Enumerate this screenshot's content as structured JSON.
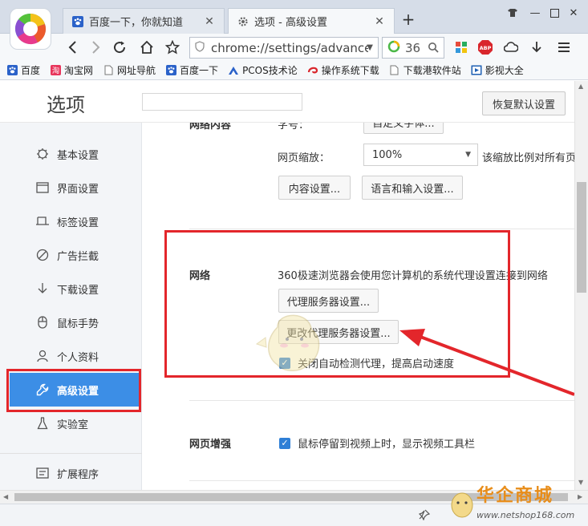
{
  "browser": {
    "tabs": [
      {
        "title": "百度一下，你就知道",
        "active": false,
        "icon": "baidu-paw-icon"
      },
      {
        "title": "选项 - 高级设置",
        "active": true,
        "icon": "gear-icon"
      }
    ],
    "address_url": "chrome://settings/advanced",
    "search_count": "36",
    "accent_color": "#3c8ee6"
  },
  "bookmarks": [
    {
      "label": "百度",
      "icon": "baidu-paw-icon"
    },
    {
      "label": "淘宝网",
      "icon": "taobao-icon"
    },
    {
      "label": "网址导航",
      "icon": "page-icon"
    },
    {
      "label": "百度一下",
      "icon": "baidu-paw-icon"
    },
    {
      "label": "PCOS技术论",
      "icon": "pcos-icon"
    },
    {
      "label": "操作系统下载",
      "icon": "swirl-icon"
    },
    {
      "label": "下载港软件站",
      "icon": "page-icon"
    },
    {
      "label": "影视大全",
      "icon": "film-icon"
    }
  ],
  "settings": {
    "title": "选项",
    "reset_label": "恢复默认设置",
    "nav": [
      {
        "label": "基本设置",
        "icon": "gear-icon"
      },
      {
        "label": "界面设置",
        "icon": "window-icon"
      },
      {
        "label": "标签设置",
        "icon": "tab-icon"
      },
      {
        "label": "广告拦截",
        "icon": "block-icon"
      },
      {
        "label": "下载设置",
        "icon": "download-icon"
      },
      {
        "label": "鼠标手势",
        "icon": "mouse-icon"
      },
      {
        "label": "个人资料",
        "icon": "person-icon"
      },
      {
        "label": "高级设置",
        "icon": "wrench-icon",
        "active": true
      },
      {
        "label": "实验室",
        "icon": "flask-icon"
      },
      {
        "label": "扩展程序",
        "icon": "extension-icon"
      }
    ],
    "web_content": {
      "label_partial": "网络内容",
      "font_size_partial": "字号：",
      "custom_font_button": "自定义字体...",
      "zoom_label": "网页缩放：",
      "zoom_value": "100%",
      "zoom_note": "该缩放比例对所有页",
      "content_settings_button": "内容设置...",
      "language_button": "语言和输入设置..."
    },
    "network": {
      "label": "网络",
      "description": "360极速浏览器会使用您计算机的系统代理设置连接到网络",
      "proxy_button": "代理服务器设置...",
      "change_proxy_button": "更改代理服务器设置...",
      "auto_detect_label": "关闭自动检测代理，提高启动速度"
    },
    "page_enhance": {
      "label": "网页增强",
      "video_toolbar_label": "鼠标停留到视频上时，显示视频工具栏"
    }
  },
  "watermark": {
    "brand": "华企商城",
    "site": "www.netshop168.com"
  }
}
